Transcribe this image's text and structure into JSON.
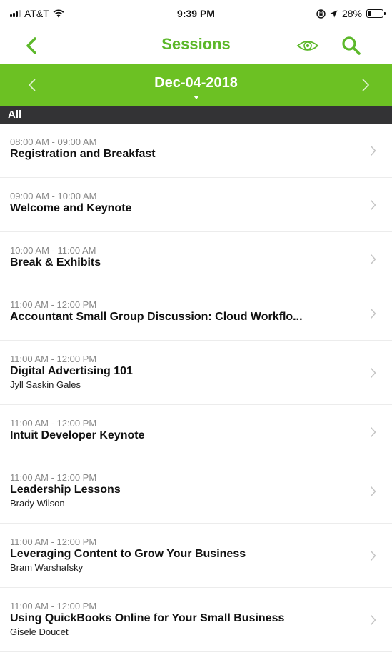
{
  "status": {
    "carrier": "AT&T",
    "time": "9:39 PM",
    "battery": "28%",
    "battery_level": 0.28
  },
  "nav": {
    "title": "Sessions",
    "back_icon": "chevron-left-icon",
    "eye_icon": "eye-icon",
    "search_icon": "search-icon"
  },
  "date_bar": {
    "date": "Dec-04-2018"
  },
  "filter": {
    "label": "All"
  },
  "sessions": [
    {
      "time": "08:00 AM - 09:00 AM",
      "title": "Registration and Breakfast",
      "speaker": ""
    },
    {
      "time": "09:00 AM - 10:00 AM",
      "title": "Welcome and Keynote",
      "speaker": ""
    },
    {
      "time": "10:00 AM - 11:00 AM",
      "title": "Break & Exhibits",
      "speaker": ""
    },
    {
      "time": "11:00 AM - 12:00 PM",
      "title": "Accountant Small Group Discussion: Cloud Workflo...",
      "speaker": ""
    },
    {
      "time": "11:00 AM - 12:00 PM",
      "title": "Digital Advertising 101",
      "speaker": "Jyll Saskin Gales"
    },
    {
      "time": "11:00 AM - 12:00 PM",
      "title": "Intuit Developer Keynote",
      "speaker": ""
    },
    {
      "time": "11:00 AM - 12:00 PM",
      "title": "Leadership Lessons",
      "speaker": "Brady Wilson"
    },
    {
      "time": "11:00 AM - 12:00 PM",
      "title": "Leveraging Content to Grow Your Business",
      "speaker": "Bram Warshafsky"
    },
    {
      "time": "11:00 AM - 12:00 PM",
      "title": "Using QuickBooks Online for Your Small Business",
      "speaker": "Gisele Doucet"
    }
  ],
  "colors": {
    "accent": "#6cc123",
    "title_green": "#5cb82a",
    "filter_bg": "#333335"
  }
}
